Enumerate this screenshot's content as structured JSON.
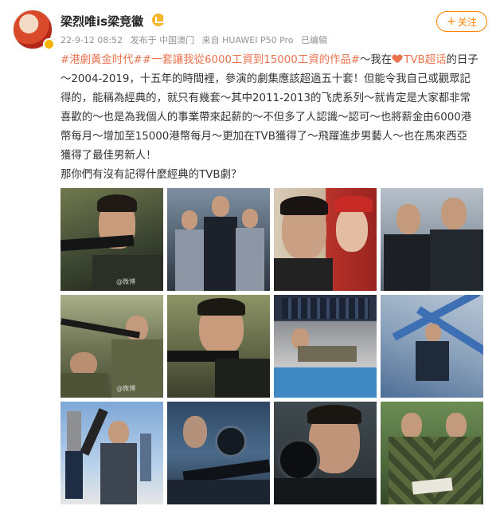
{
  "user": {
    "name": "梁烈唯is梁竞徽",
    "follow_label": "关注",
    "follow_plus": "+"
  },
  "meta": {
    "date": "22-9-12 08:52",
    "location": "发布于 中国澳门",
    "device": "来自 HUAWEI P50 Pro",
    "edited": "已编辑"
  },
  "post": {
    "hashtag_1": "#港劇黃金时代#",
    "hashtag_2": "#一套讓我從6000工資到15000工資的作品#",
    "line1_tail": "～我在",
    "tvb_link": "TVB超话",
    "line2_tail": "的日子",
    "line2": "～2004-2019，十五年的時間裡，參演的劇集應該超過五十套！但能令我自己或觀眾記",
    "line3": "得的，能稱為經典的，就只有幾套～其中2011-2013的飞虎系列～就肯定是大家都非常",
    "line4": "喜歡的～也是為我個人的事業帶來起薪的～不但多了人認識～認可～也將薪金由6000港",
    "line5": "幣每月～增加至15000港幣每月～更加在TVB獲得了～飛躍進步男藝人～也在馬來西亞",
    "line6": "獲得了最佳男新人！",
    "line7": "那你們有沒有記得什麼經典的TVB劇？"
  },
  "photos": [
    {
      "name": "photo-sniper-closeup",
      "watermark": "@微博"
    },
    {
      "name": "photo-three-officers",
      "watermark": ""
    },
    {
      "name": "photo-couple-kiss",
      "watermark": ""
    },
    {
      "name": "photo-two-officers",
      "watermark": ""
    },
    {
      "name": "photo-soldiers-aiming",
      "watermark": "@微博"
    },
    {
      "name": "photo-rifle-aim",
      "watermark": ""
    },
    {
      "name": "photo-prone-training",
      "watermark": ""
    },
    {
      "name": "photo-climbing",
      "watermark": ""
    },
    {
      "name": "photo-rooftop-gunner",
      "watermark": ""
    },
    {
      "name": "photo-scope-aim",
      "watermark": ""
    },
    {
      "name": "photo-scope-closeup",
      "watermark": ""
    },
    {
      "name": "photo-camo-soldiers",
      "watermark": ""
    }
  ],
  "colors": {
    "hashtag": "#eb7350",
    "follow": "#ff8200",
    "text": "#333333",
    "meta": "#939393"
  }
}
